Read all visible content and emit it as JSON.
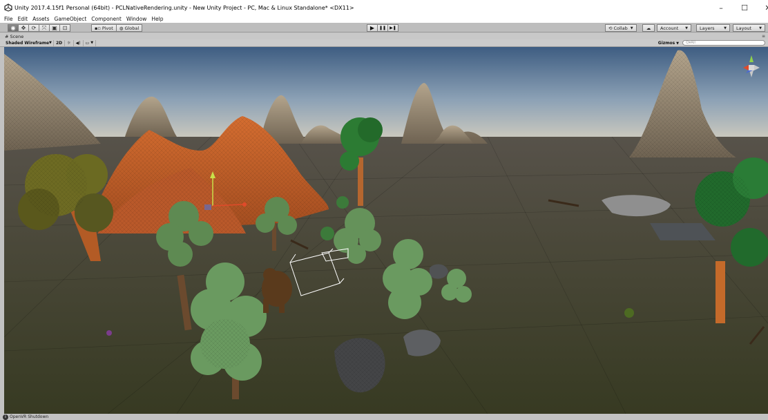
{
  "window": {
    "title": "Unity 2017.4.15f1 Personal (64bit) - PCLNativeRendering.unity - New Unity Project - PC, Mac & Linux Standalone* <DX11>",
    "controls": {
      "minimize": "–",
      "maximize": "☐",
      "close": "✕"
    }
  },
  "menu": {
    "items": [
      "File",
      "Edit",
      "Assets",
      "GameObject",
      "Component",
      "Window",
      "Help"
    ]
  },
  "toolbar": {
    "transform_tools": [
      {
        "name": "hand-tool",
        "glyph": "◉"
      },
      {
        "name": "move-tool",
        "glyph": "✥"
      },
      {
        "name": "rotate-tool",
        "glyph": "⟳"
      },
      {
        "name": "scale-tool",
        "glyph": "⤧"
      },
      {
        "name": "rect-tool",
        "glyph": "▣"
      },
      {
        "name": "transform-tool",
        "glyph": "⊡"
      }
    ],
    "pivot_label": "Pivot",
    "global_label": "Global",
    "play": "▶",
    "pause": "❚❚",
    "step": "▶❚",
    "collab_label": "Collab",
    "account_label": "Account",
    "layers_label": "Layers",
    "layout_label": "Layout"
  },
  "scene_tab": {
    "label": "Scene"
  },
  "scene_toolbar": {
    "shading_mode": "Shaded Wireframe",
    "mode_2d": "2D",
    "lighting": "☼",
    "audio": "◀)",
    "effects": "▭",
    "gizmos_label": "Gizmos",
    "search_placeholder": "Q▾All"
  },
  "status": {
    "message": "OpenVR Shutdown"
  },
  "colors": {
    "sky_top": "#4d6a8c",
    "sky_horizon": "#c9c4b5",
    "ground": "#4b4a3d",
    "orange_mountain": "#c8622a",
    "tree_green": "#5a8a4a"
  }
}
